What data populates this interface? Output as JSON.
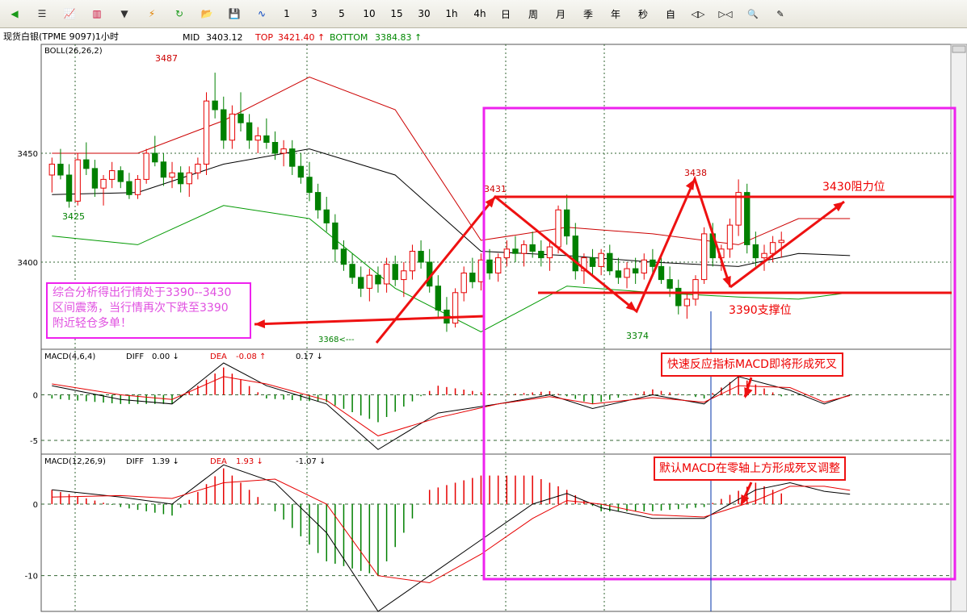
{
  "toolbar": {
    "icons": [
      "back-arrow-icon",
      "list-icon",
      "line-chart-icon",
      "bar-chart-icon",
      "dropdown-arrow-icon",
      "lightning-icon",
      "refresh-icon",
      "open-folder-icon",
      "save-disk-icon",
      "wave-icon"
    ],
    "periods": [
      "1",
      "3",
      "5",
      "10",
      "15",
      "30",
      "1h",
      "4h",
      "日",
      "周",
      "月",
      "季",
      "年",
      "秒",
      "自"
    ],
    "tools": [
      "shrink-icon",
      "expand-icon",
      "zoom-icon",
      "pencil-icon"
    ]
  },
  "header": {
    "instrument": "现货白银(TPME 9097)1小时",
    "mid_label": "MID",
    "mid_value": "3403.12",
    "top_label": "TOP",
    "top_value": "3421.40 ↑",
    "bottom_label": "BOTTOM",
    "bottom_value": "3384.83 ↑"
  },
  "colors": {
    "up": "#e60000",
    "down": "#008000",
    "mid_line": "#000000",
    "upper_band": "#cc0000",
    "lower_band": "#009900",
    "annotation": "#ee1111",
    "highlight_box": "#ee22ee",
    "grid": "#336633"
  },
  "chart_data": [
    {
      "type": "candlestick",
      "panel": "price",
      "indicator_label": "BOLL(26,26,2)",
      "ylim": [
        3360,
        3500
      ],
      "yticks": [
        3400,
        3450
      ],
      "candles": [
        [
          3440,
          3448,
          3432,
          3445
        ],
        [
          3445,
          3452,
          3438,
          3440
        ],
        [
          3440,
          3445,
          3425,
          3428
        ],
        [
          3428,
          3450,
          3426,
          3447
        ],
        [
          3447,
          3455,
          3440,
          3443
        ],
        [
          3443,
          3447,
          3430,
          3434
        ],
        [
          3434,
          3440,
          3426,
          3438
        ],
        [
          3438,
          3446,
          3434,
          3442
        ],
        [
          3442,
          3444,
          3434,
          3437
        ],
        [
          3437,
          3441,
          3429,
          3431
        ],
        [
          3431,
          3440,
          3429,
          3438
        ],
        [
          3438,
          3452,
          3436,
          3450
        ],
        [
          3450,
          3458,
          3444,
          3446
        ],
        [
          3446,
          3450,
          3435,
          3439
        ],
        [
          3439,
          3446,
          3434,
          3441
        ],
        [
          3441,
          3444,
          3432,
          3436
        ],
        [
          3436,
          3444,
          3430,
          3441
        ],
        [
          3441,
          3448,
          3438,
          3445
        ],
        [
          3445,
          3478,
          3440,
          3474
        ],
        [
          3474,
          3487,
          3466,
          3470
        ],
        [
          3470,
          3476,
          3452,
          3456
        ],
        [
          3456,
          3472,
          3452,
          3468
        ],
        [
          3468,
          3478,
          3460,
          3464
        ],
        [
          3464,
          3468,
          3452,
          3456
        ],
        [
          3456,
          3462,
          3450,
          3458
        ],
        [
          3458,
          3466,
          3452,
          3455
        ],
        [
          3455,
          3460,
          3447,
          3450
        ],
        [
          3450,
          3456,
          3444,
          3452
        ],
        [
          3452,
          3456,
          3440,
          3444
        ],
        [
          3444,
          3450,
          3436,
          3439
        ],
        [
          3439,
          3446,
          3428,
          3432
        ],
        [
          3432,
          3436,
          3420,
          3424
        ],
        [
          3424,
          3430,
          3414,
          3418
        ],
        [
          3418,
          3422,
          3400,
          3406
        ],
        [
          3406,
          3410,
          3396,
          3399
        ],
        [
          3399,
          3404,
          3390,
          3393
        ],
        [
          3393,
          3398,
          3384,
          3388
        ],
        [
          3388,
          3397,
          3382,
          3394
        ],
        [
          3394,
          3398,
          3386,
          3390
        ],
        [
          3390,
          3402,
          3386,
          3399
        ],
        [
          3399,
          3403,
          3389,
          3392
        ],
        [
          3392,
          3400,
          3384,
          3396
        ],
        [
          3396,
          3408,
          3392,
          3405
        ],
        [
          3405,
          3410,
          3397,
          3400
        ],
        [
          3400,
          3406,
          3386,
          3389
        ],
        [
          3389,
          3394,
          3374,
          3378
        ],
        [
          3378,
          3384,
          3368,
          3372
        ],
        [
          3372,
          3388,
          3370,
          3386
        ],
        [
          3386,
          3398,
          3382,
          3395
        ],
        [
          3395,
          3402,
          3388,
          3391
        ],
        [
          3391,
          3404,
          3387,
          3401
        ],
        [
          3401,
          3406,
          3392,
          3395
        ],
        [
          3395,
          3404,
          3391,
          3402
        ],
        [
          3402,
          3410,
          3398,
          3406
        ],
        [
          3406,
          3412,
          3400,
          3404
        ],
        [
          3404,
          3410,
          3398,
          3408
        ],
        [
          3408,
          3414,
          3402,
          3405
        ],
        [
          3405,
          3410,
          3398,
          3402
        ],
        [
          3402,
          3410,
          3396,
          3407
        ],
        [
          3407,
          3426,
          3404,
          3424
        ],
        [
          3424,
          3431,
          3408,
          3412
        ],
        [
          3412,
          3418,
          3392,
          3396
        ],
        [
          3396,
          3404,
          3390,
          3402
        ],
        [
          3402,
          3406,
          3394,
          3398
        ],
        [
          3398,
          3406,
          3394,
          3404
        ],
        [
          3404,
          3408,
          3394,
          3396
        ],
        [
          3396,
          3402,
          3390,
          3393
        ],
        [
          3393,
          3400,
          3388,
          3397
        ],
        [
          3397,
          3402,
          3390,
          3395
        ],
        [
          3395,
          3404,
          3392,
          3401
        ],
        [
          3401,
          3406,
          3394,
          3398
        ],
        [
          3398,
          3402,
          3390,
          3392
        ],
        [
          3392,
          3398,
          3384,
          3388
        ],
        [
          3388,
          3392,
          3376,
          3380
        ],
        [
          3380,
          3386,
          3374,
          3383
        ],
        [
          3383,
          3394,
          3380,
          3392
        ],
        [
          3392,
          3416,
          3390,
          3413
        ],
        [
          3413,
          3418,
          3398,
          3402
        ],
        [
          3402,
          3408,
          3396,
          3406
        ],
        [
          3406,
          3420,
          3402,
          3417
        ],
        [
          3417,
          3438,
          3412,
          3432
        ],
        [
          3432,
          3436,
          3404,
          3408
        ],
        [
          3408,
          3414,
          3398,
          3402
        ],
        [
          3402,
          3408,
          3396,
          3404
        ],
        [
          3404,
          3412,
          3400,
          3409
        ],
        [
          3409,
          3414,
          3402,
          3410
        ]
      ],
      "boll": {
        "mid": [
          [
            0,
            3431
          ],
          [
            10,
            3432
          ],
          [
            20,
            3445
          ],
          [
            30,
            3452
          ],
          [
            40,
            3440
          ],
          [
            50,
            3405
          ],
          [
            60,
            3403
          ],
          [
            70,
            3400
          ],
          [
            80,
            3398
          ],
          [
            87,
            3404
          ],
          [
            93,
            3403
          ]
        ],
        "upper": [
          [
            0,
            3450
          ],
          [
            10,
            3450
          ],
          [
            20,
            3465
          ],
          [
            30,
            3485
          ],
          [
            40,
            3470
          ],
          [
            50,
            3410
          ],
          [
            60,
            3416
          ],
          [
            70,
            3413
          ],
          [
            80,
            3408
          ],
          [
            87,
            3420
          ],
          [
            93,
            3420
          ]
        ],
        "lower": [
          [
            0,
            3412
          ],
          [
            10,
            3408
          ],
          [
            20,
            3426
          ],
          [
            30,
            3420
          ],
          [
            40,
            3388
          ],
          [
            50,
            3368
          ],
          [
            60,
            3389
          ],
          [
            70,
            3386
          ],
          [
            80,
            3384
          ],
          [
            87,
            3383
          ],
          [
            93,
            3386
          ]
        ]
      },
      "price_labels": [
        "3487",
        "3425",
        "3368",
        "3431",
        "3374",
        "3438",
        "3430阻力位",
        "3390支撑位"
      ]
    },
    {
      "type": "macd",
      "panel": "macd-fast",
      "label": "MACD(4,6,4)",
      "diff_label": "DIFF",
      "diff_value": "0.00 ↓",
      "dea_label": "DEA",
      "dea_value": "-0.08 ↑",
      "hist_value": "0.17 ↓",
      "ylim": [
        -6.5,
        5
      ],
      "yticks": [
        0,
        -5
      ],
      "diff": [
        [
          0,
          1
        ],
        [
          8,
          -0.5
        ],
        [
          14,
          -1
        ],
        [
          20,
          3.5
        ],
        [
          25,
          1
        ],
        [
          32,
          -1
        ],
        [
          38,
          -6
        ],
        [
          45,
          -2
        ],
        [
          52,
          -1
        ],
        [
          58,
          0
        ],
        [
          63,
          -1.5
        ],
        [
          70,
          0
        ],
        [
          76,
          -1
        ],
        [
          80,
          2
        ],
        [
          86,
          0.5
        ],
        [
          90,
          -1
        ],
        [
          93,
          0
        ]
      ],
      "dea": [
        [
          0,
          1.2
        ],
        [
          8,
          0
        ],
        [
          14,
          -0.5
        ],
        [
          20,
          2
        ],
        [
          25,
          1.2
        ],
        [
          32,
          -0.6
        ],
        [
          38,
          -4.5
        ],
        [
          45,
          -2.5
        ],
        [
          52,
          -1
        ],
        [
          58,
          -0.2
        ],
        [
          63,
          -1
        ],
        [
          70,
          -0.3
        ],
        [
          76,
          -0.8
        ],
        [
          80,
          1
        ],
        [
          86,
          0.8
        ],
        [
          90,
          -0.8
        ],
        [
          93,
          -0.08
        ]
      ]
    },
    {
      "type": "macd",
      "panel": "macd-default",
      "label": "MACD(12,26,9)",
      "diff_label": "DIFF",
      "diff_value": "1.39 ↓",
      "dea_label": "DEA",
      "dea_value": "1.93 ↓",
      "hist_value": "-1.07 ↓",
      "ylim": [
        -15,
        7
      ],
      "yticks": [
        0,
        -10
      ],
      "diff": [
        [
          0,
          2
        ],
        [
          8,
          1
        ],
        [
          14,
          0
        ],
        [
          20,
          5.5
        ],
        [
          26,
          3
        ],
        [
          32,
          -4
        ],
        [
          38,
          -15
        ],
        [
          44,
          -10
        ],
        [
          50,
          -5
        ],
        [
          56,
          0
        ],
        [
          60,
          1.5
        ],
        [
          64,
          -0.5
        ],
        [
          70,
          -2
        ],
        [
          76,
          -2
        ],
        [
          82,
          2
        ],
        [
          86,
          3
        ],
        [
          90,
          1.8
        ],
        [
          93,
          1.39
        ]
      ],
      "dea": [
        [
          0,
          1
        ],
        [
          8,
          1.2
        ],
        [
          14,
          0.8
        ],
        [
          20,
          3
        ],
        [
          26,
          3.5
        ],
        [
          32,
          0
        ],
        [
          38,
          -10
        ],
        [
          44,
          -11
        ],
        [
          50,
          -7
        ],
        [
          56,
          -2
        ],
        [
          60,
          0.5
        ],
        [
          64,
          0
        ],
        [
          70,
          -1.5
        ],
        [
          76,
          -1.8
        ],
        [
          82,
          0.5
        ],
        [
          86,
          2.5
        ],
        [
          90,
          2.5
        ],
        [
          93,
          1.93
        ]
      ]
    }
  ],
  "annotations": {
    "analysis_text_1": "综合分析得出行情处于3390--3430",
    "analysis_text_2": "区间震荡，当行情再次下跌至3390",
    "analysis_text_3": "附近轻仓多单！",
    "fast_macd_note": "快速反应指标MACD即将形成死叉",
    "default_macd_note": "默认MACD在零轴上方形成死叉调整"
  }
}
